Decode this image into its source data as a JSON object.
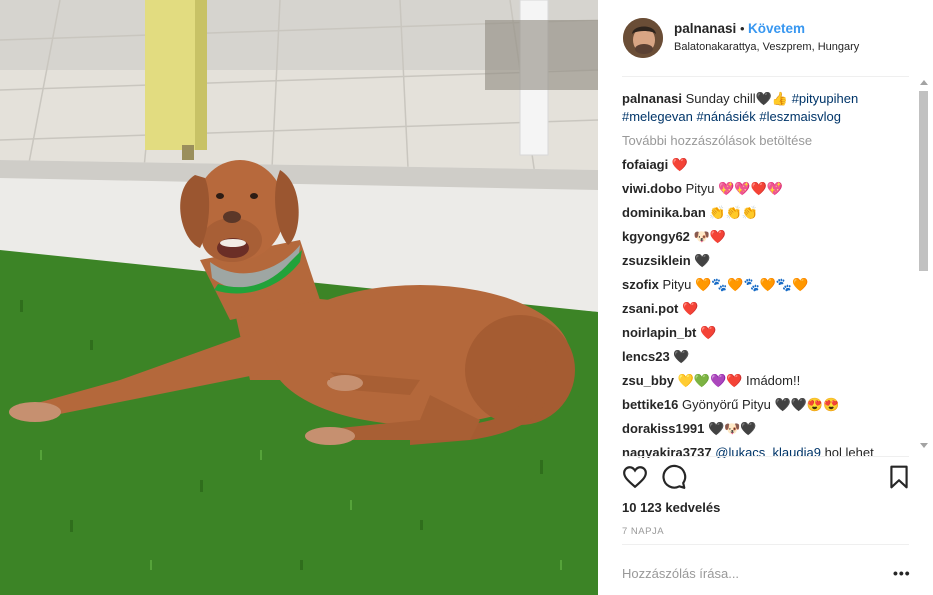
{
  "post": {
    "username": "palnanasi",
    "separator": "•",
    "follow_label": "Követem",
    "location": "Balatonakarattya, Veszprem, Hungary"
  },
  "caption": {
    "user": "palnanasi",
    "text": "Sunday chill🖤👍",
    "tags": [
      "#pityupihen",
      "#melegevan",
      "#nánásiék",
      "#leszmaisvlog"
    ]
  },
  "load_more": "További hozzászólások betöltése",
  "comments": [
    {
      "user": "fofaiagi",
      "text": "❤️"
    },
    {
      "user": "viwi.dobo",
      "text": "Pityu 💖💖❤️💖"
    },
    {
      "user": "dominika.ban",
      "text": "👏👏👏"
    },
    {
      "user": "kgyongy62",
      "text": "🐶❤️"
    },
    {
      "user": "zsuzsiklein",
      "text": "🖤"
    },
    {
      "user": "szofix",
      "text": "Pityu 🧡🐾🧡🐾🧡🐾🧡"
    },
    {
      "user": "zsani.pot",
      "text": "❤️"
    },
    {
      "user": "noirlapin_bt",
      "text": "❤️"
    },
    {
      "user": "lencs23",
      "text": "🖤"
    },
    {
      "user": "zsu_bby",
      "text": "💛💚💜❤️ Imádom!!"
    },
    {
      "user": "bettike16",
      "text": "Gyönyörű Pityu 🖤🖤😍😍"
    },
    {
      "user": "dorakiss1991",
      "text": "🖤🐶🖤"
    },
    {
      "user": "nagyakira3737",
      "mention": "@lukacs_klaudia9",
      "text": "hol lehet"
    }
  ],
  "stats": {
    "likes": "10 123 kedvelés",
    "time_ago": "7 NAPJA"
  },
  "add_comment": {
    "placeholder": "Hozzászólás írása...",
    "more": "•••"
  },
  "icons": {
    "like": "heart-icon",
    "comment": "comment-icon",
    "save": "bookmark-icon"
  },
  "colors": {
    "follow": "#3897f0",
    "hashtag": "#003569",
    "muted": "#999999",
    "divider": "#efefef"
  }
}
